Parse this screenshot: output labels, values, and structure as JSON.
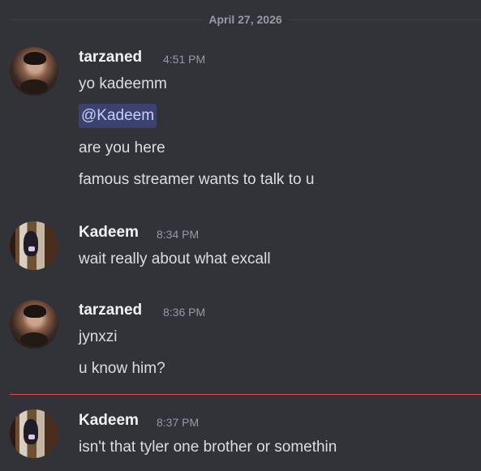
{
  "date_divider": "April 27, 2026",
  "messages": [
    {
      "author": "tarzaned",
      "time": "4:51 PM",
      "lines": [
        "yo kadeemm",
        "@Kadeem",
        "are you here",
        "famous streamer wants to talk to u"
      ]
    },
    {
      "author": "Kadeem",
      "time": "8:34 PM",
      "lines": [
        "wait really about what excall"
      ]
    },
    {
      "author": "tarzaned",
      "time": "8:36 PM",
      "lines": [
        "jynxzi",
        "u know him?"
      ]
    },
    {
      "author": "Kadeem",
      "time": "8:37 PM",
      "lines": [
        "isn't that tyler one brother or somethin"
      ]
    }
  ],
  "colors": {
    "background": "#313338",
    "username": "#f2f3f5",
    "timestamp": "#949ba4",
    "message_text": "#dbdee1",
    "mention_bg": "#3c4270",
    "mention_text": "#c9cdfb",
    "new_message_divider": "#e5484d"
  }
}
